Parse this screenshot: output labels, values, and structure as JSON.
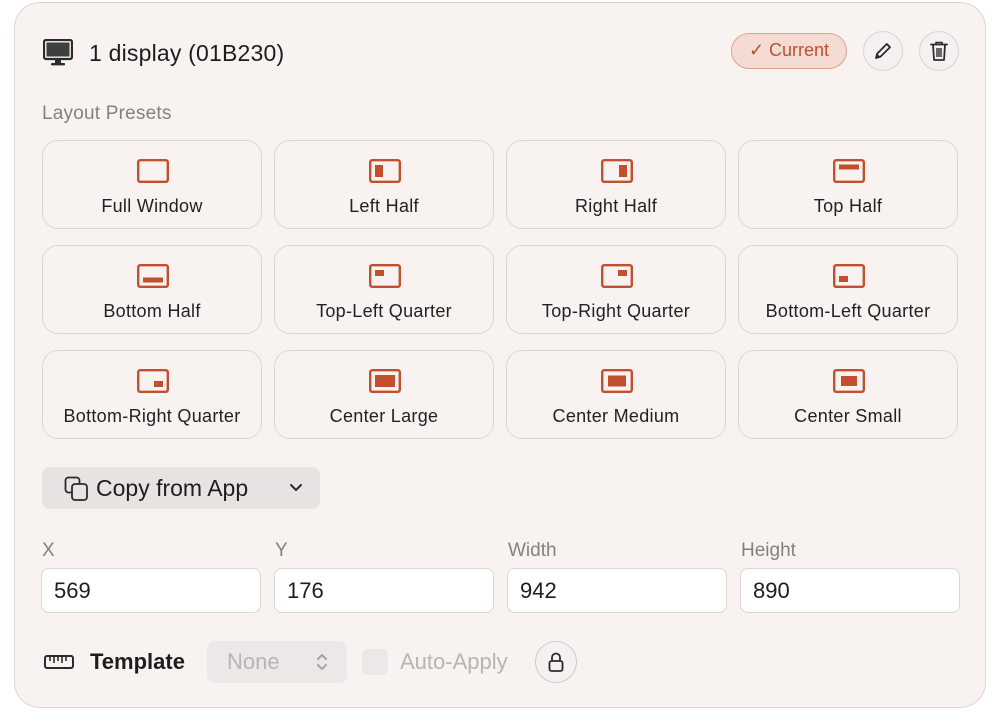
{
  "header": {
    "title": "1 display (01B230)",
    "badge": "✓ Current",
    "icons": {
      "display": "monitor-icon",
      "edit": "pencil-icon",
      "delete": "trash-icon"
    }
  },
  "presets": {
    "section_label": "Layout Presets",
    "items": [
      {
        "label": "Full Window",
        "icon": "full-window-icon"
      },
      {
        "label": "Left Half",
        "icon": "left-half-icon"
      },
      {
        "label": "Right Half",
        "icon": "right-half-icon"
      },
      {
        "label": "Top Half",
        "icon": "top-half-icon"
      },
      {
        "label": "Bottom Half",
        "icon": "bottom-half-icon"
      },
      {
        "label": "Top-Left Quarter",
        "icon": "top-left-quarter-icon"
      },
      {
        "label": "Top-Right Quarter",
        "icon": "top-right-quarter-icon"
      },
      {
        "label": "Bottom-Left Quarter",
        "icon": "bottom-left-quarter-icon"
      },
      {
        "label": "Bottom-Right Quarter",
        "icon": "bottom-right-quarter-icon"
      },
      {
        "label": "Center Large",
        "icon": "center-large-icon"
      },
      {
        "label": "Center Medium",
        "icon": "center-medium-icon"
      },
      {
        "label": "Center Small",
        "icon": "center-small-icon"
      }
    ]
  },
  "copy_from_app": {
    "label": "Copy from App"
  },
  "frame": {
    "x": {
      "label": "X",
      "value": "569"
    },
    "y": {
      "label": "Y",
      "value": "176"
    },
    "width": {
      "label": "Width",
      "value": "942"
    },
    "height": {
      "label": "Height",
      "value": "890"
    }
  },
  "template": {
    "label": "Template",
    "selected": "None",
    "auto_apply_label": "Auto-Apply",
    "auto_apply_checked": false
  },
  "colors": {
    "accent": "#c2502f",
    "badge_bg": "#f5dcd3",
    "card_bg": "#f8f2f1",
    "border": "#dcd7d6",
    "muted_text": "#86817f"
  }
}
